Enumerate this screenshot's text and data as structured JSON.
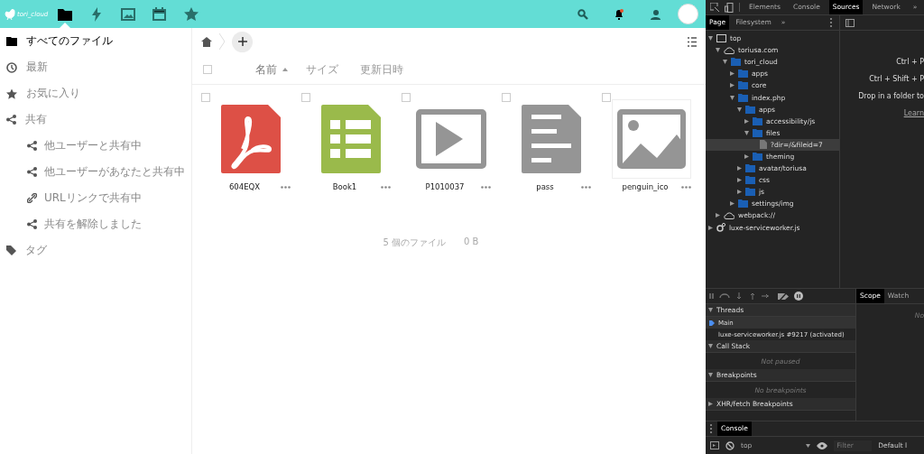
{
  "header": {
    "logo_text": "tori_cloud",
    "apps": [
      {
        "kind": "files",
        "selected": true
      },
      {
        "kind": "activity",
        "selected": false
      },
      {
        "kind": "gallery",
        "selected": false
      },
      {
        "kind": "calendar",
        "selected": false
      },
      {
        "kind": "favorites",
        "selected": false
      }
    ],
    "notifications_unread": true
  },
  "sidebar": {
    "items": [
      {
        "kind": "folder",
        "label": "すべてのファイル",
        "selected": true
      },
      {
        "kind": "clock",
        "label": "最新",
        "selected": false
      },
      {
        "kind": "star",
        "label": "お気に入り",
        "selected": false
      },
      {
        "kind": "share",
        "label": "共有",
        "selected": false,
        "children": [
          {
            "kind": "share",
            "label": "他ユーザーと共有中",
            "selected": false
          },
          {
            "kind": "share",
            "label": "他ユーザーがあなたと共有中",
            "selected": false
          },
          {
            "kind": "link",
            "label": "URLリンクで共有中",
            "selected": false
          },
          {
            "kind": "unshare",
            "label": "共有を解除しました",
            "selected": false
          }
        ]
      },
      {
        "kind": "tag",
        "label": "タグ",
        "selected": false
      }
    ]
  },
  "select_all_checked": false,
  "columns": [
    {
      "label": "名前",
      "sorted": true
    },
    {
      "label": "サイズ",
      "sorted": false
    },
    {
      "label": "更新日時",
      "sorted": false
    }
  ],
  "files": [
    {
      "name": "604EQX",
      "kind": "pdf",
      "checked": false
    },
    {
      "name": "Book1",
      "kind": "spreadsheet",
      "checked": false
    },
    {
      "name": "P1010037",
      "kind": "video",
      "checked": false
    },
    {
      "name": "pass",
      "kind": "text",
      "checked": false
    },
    {
      "name": "penguin_ico",
      "kind": "image",
      "checked": false
    }
  ],
  "summary": {
    "count": "5 個のファイル",
    "size": "0 B"
  },
  "devtools": {
    "tabs": [
      {
        "label": "Elements",
        "selected": false
      },
      {
        "label": "Console",
        "selected": false
      },
      {
        "label": "Sources",
        "selected": true
      },
      {
        "label": "Network",
        "selected": false
      }
    ],
    "more": "»",
    "nav_tabs": [
      {
        "label": "Page",
        "selected": true
      },
      {
        "label": "Filesystem",
        "selected": false
      }
    ],
    "nav_more": "»",
    "tree": [
      {
        "kind": "frame",
        "label": "top",
        "expanded": true,
        "selected": false,
        "children": [
          {
            "kind": "domain",
            "label": "toriusa.com",
            "expanded": true,
            "selected": false,
            "children": [
              {
                "kind": "folder",
                "label": "tori_cloud",
                "expanded": true,
                "selected": false,
                "children": [
                  {
                    "kind": "folder",
                    "label": "apps",
                    "expanded": false,
                    "selected": false
                  },
                  {
                    "kind": "folder",
                    "label": "core",
                    "expanded": false,
                    "selected": false
                  },
                  {
                    "kind": "folder",
                    "label": "index.php",
                    "expanded": true,
                    "selected": false,
                    "children": [
                      {
                        "kind": "folder",
                        "label": "apps",
                        "expanded": true,
                        "selected": false,
                        "children": [
                          {
                            "kind": "folder",
                            "label": "accessibility/js",
                            "expanded": false,
                            "selected": false
                          },
                          {
                            "kind": "folder",
                            "label": "files",
                            "expanded": true,
                            "selected": false,
                            "children": [
                              {
                                "kind": "file",
                                "label": "?dir=/&fileid=7",
                                "selected": true
                              }
                            ]
                          },
                          {
                            "kind": "folder",
                            "label": "theming",
                            "expanded": false,
                            "selected": false
                          }
                        ]
                      },
                      {
                        "kind": "folder",
                        "label": "avatar/toriusa",
                        "expanded": false,
                        "selected": false
                      },
                      {
                        "kind": "folder",
                        "label": "css",
                        "expanded": false,
                        "selected": false
                      },
                      {
                        "kind": "folder",
                        "label": "js",
                        "expanded": false,
                        "selected": false
                      }
                    ]
                  },
                  {
                    "kind": "folder",
                    "label": "settings/img",
                    "expanded": false,
                    "selected": false
                  }
                ]
              }
            ]
          },
          {
            "kind": "domain",
            "label": "webpack://",
            "expanded": false,
            "selected": false
          }
        ]
      },
      {
        "kind": "worker",
        "label": "luxe-serviceworker.js",
        "expanded": false,
        "selected": false
      }
    ],
    "shortcuts": [
      "Ctrl + P",
      "Ctrl + Shift + P",
      "Drop in a folder to"
    ],
    "learn_link": "Learn",
    "sections": [
      {
        "title": "Threads",
        "expanded": true,
        "items": [
          {
            "label": "Main",
            "selected": true
          },
          {
            "label": "luxe-serviceworker.js #9217 (activated)",
            "selected": false
          }
        ]
      },
      {
        "title": "Call Stack",
        "expanded": true,
        "empty": "Not paused"
      },
      {
        "title": "Breakpoints",
        "expanded": true,
        "empty": "No breakpoints"
      },
      {
        "title": "XHR/fetch Breakpoints",
        "expanded": false
      }
    ],
    "scope_tabs": [
      {
        "label": "Scope",
        "selected": true
      },
      {
        "label": "Watch",
        "selected": false
      }
    ],
    "scope_text": "No",
    "drawer_tab": "Console",
    "context": "top",
    "filter": {
      "placeholder": "Filter"
    },
    "levels": "Default l"
  }
}
